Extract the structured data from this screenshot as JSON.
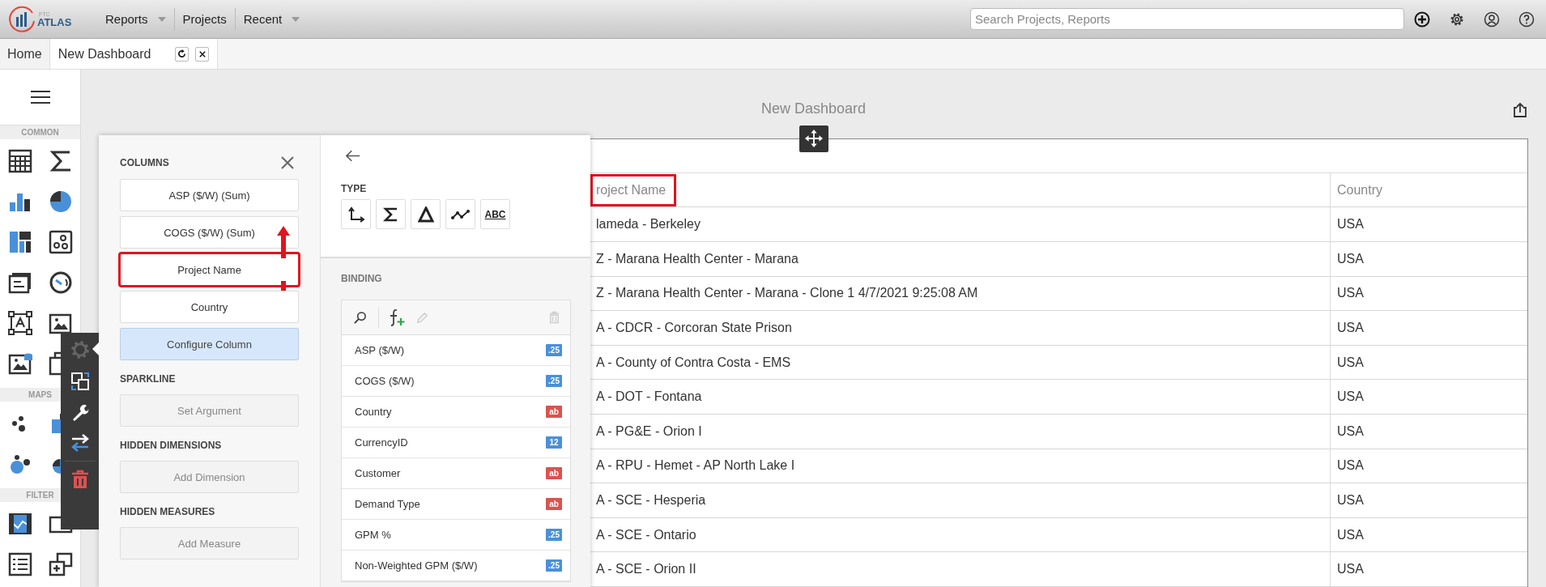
{
  "app": {
    "logo_small": "FTC",
    "logo": "ATLAS",
    "nav": [
      {
        "label": "Reports",
        "has_menu": true
      },
      {
        "label": "Projects",
        "has_menu": false
      },
      {
        "label": "Recent",
        "has_menu": true
      }
    ],
    "search": {
      "placeholder": "Search Projects, Reports"
    }
  },
  "tabs": [
    {
      "label": "Home",
      "selected": false,
      "closable": false
    },
    {
      "label": "New Dashboard",
      "selected": true,
      "closable": true
    }
  ],
  "sidebar": {
    "sections": [
      {
        "title": "COMMON"
      },
      {
        "title": "MAPS"
      },
      {
        "title": "FILTER"
      }
    ]
  },
  "dashboard": {
    "title": "New Dashboard"
  },
  "table": {
    "columns": [
      {
        "label": "roject Name",
        "highlighted": true
      },
      {
        "label": "Country",
        "highlighted": false
      }
    ],
    "rows": [
      [
        "lameda - Berkeley",
        "USA"
      ],
      [
        "Z - Marana Health Center - Marana",
        "USA"
      ],
      [
        "Z - Marana Health Center - Marana - Clone 1 4/7/2021 9:25:08 AM",
        "USA"
      ],
      [
        "A - CDCR - Corcoran State Prison",
        "USA"
      ],
      [
        "A - County of Contra Costa - EMS",
        "USA"
      ],
      [
        "A - DOT - Fontana",
        "USA"
      ],
      [
        "A - PG&E - Orion I",
        "USA"
      ],
      [
        "A - RPU - Hemet - AP North Lake I",
        "USA"
      ],
      [
        "A - SCE - Hesperia",
        "USA"
      ],
      [
        "A - SCE - Ontario",
        "USA"
      ],
      [
        "A - SCE - Orion II",
        "USA"
      ]
    ]
  },
  "editor": {
    "columns_title": "COLUMNS",
    "columns": [
      {
        "label": "ASP ($/W) (Sum)",
        "highlighted": false
      },
      {
        "label": "COGS ($/W) (Sum)",
        "highlighted": false
      },
      {
        "label": "Project Name",
        "highlighted": true
      },
      {
        "label": "Country",
        "highlighted": false
      }
    ],
    "configure": "Configure Column",
    "sections": [
      {
        "title": "SPARKLINE",
        "button": "Set Argument"
      },
      {
        "title": "HIDDEN DIMENSIONS",
        "button": "Add Dimension"
      },
      {
        "title": "HIDDEN MEASURES",
        "button": "Add Measure"
      }
    ],
    "type_title": "TYPE",
    "types": [
      {
        "kind": "dimension"
      },
      {
        "kind": "measure"
      },
      {
        "kind": "delta"
      },
      {
        "kind": "sparkline"
      },
      {
        "kind": "text",
        "label": "ABC"
      }
    ],
    "binding_title": "BINDING",
    "fields": [
      {
        "name": "ASP ($/W)",
        "badge": ".25",
        "color": "#4a90d9"
      },
      {
        "name": "COGS ($/W)",
        "badge": ".25",
        "color": "#4a90d9"
      },
      {
        "name": "Country",
        "badge": "ab",
        "color": "#d9534f"
      },
      {
        "name": "CurrencyID",
        "badge": "12",
        "color": "#4a90d9"
      },
      {
        "name": "Customer",
        "badge": "ab",
        "color": "#d9534f"
      },
      {
        "name": "Demand Type",
        "badge": "ab",
        "color": "#d9534f"
      },
      {
        "name": "GPM %",
        "badge": ".25",
        "color": "#4a90d9"
      },
      {
        "name": "Non-Weighted GPM ($/W)",
        "badge": ".25",
        "color": "#4a90d9"
      }
    ]
  }
}
